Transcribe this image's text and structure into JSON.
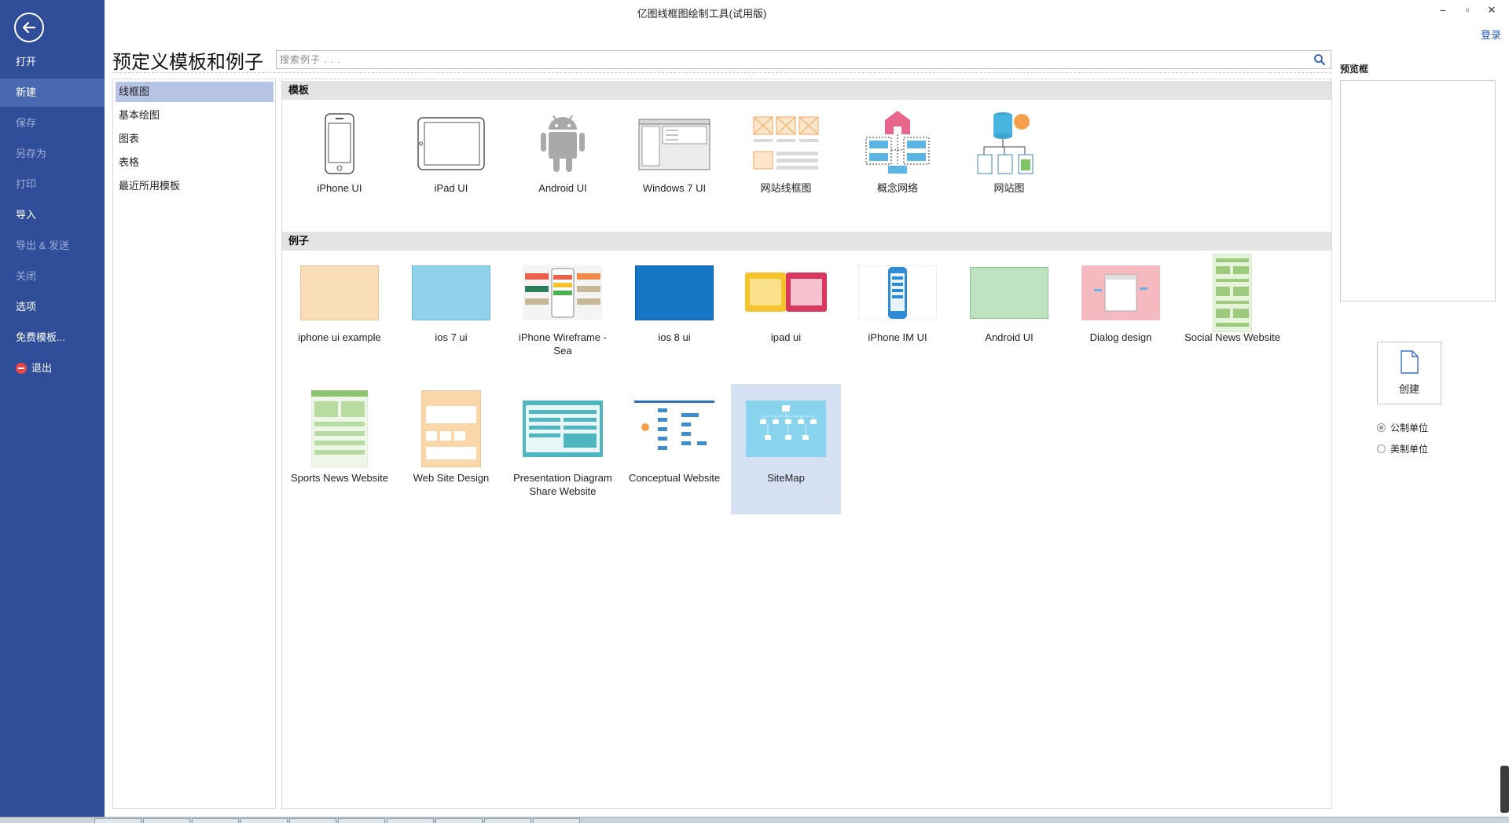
{
  "window": {
    "title": "亿图线框图绘制工具(试用版)",
    "minimize": "–",
    "restore": "▫",
    "close": "✕",
    "login": "登录"
  },
  "leftnav": {
    "items": [
      {
        "label": "打开",
        "state": "normal"
      },
      {
        "label": "新建",
        "state": "active"
      },
      {
        "label": "保存",
        "state": "disabled"
      },
      {
        "label": "另存为",
        "state": "disabled"
      },
      {
        "label": "打印",
        "state": "disabled"
      },
      {
        "label": "导入",
        "state": "normal"
      },
      {
        "label": "导出 & 发送",
        "state": "disabled"
      },
      {
        "label": "关闭",
        "state": "disabled"
      },
      {
        "label": "选项",
        "state": "normal"
      },
      {
        "label": "免费模板...",
        "state": "normal"
      },
      {
        "label": "退出",
        "state": "normal"
      }
    ]
  },
  "header": {
    "title": "预定义模板和例子",
    "search_placeholder": "搜索例子 . . ."
  },
  "categories": [
    {
      "label": "线框图",
      "active": true
    },
    {
      "label": "基本绘图",
      "active": false
    },
    {
      "label": "图表",
      "active": false
    },
    {
      "label": "表格",
      "active": false
    },
    {
      "label": "最近所用模板",
      "active": false
    }
  ],
  "sections": {
    "templates": {
      "title": "模板",
      "items": [
        {
          "label": "iPhone UI",
          "icon": "iphone-icon"
        },
        {
          "label": "iPad UI",
          "icon": "ipad-icon"
        },
        {
          "label": "Android UI",
          "icon": "android-icon"
        },
        {
          "label": "Windows 7 UI",
          "icon": "windows-window-icon"
        },
        {
          "label": "网站线框图",
          "icon": "website-wireframe-icon"
        },
        {
          "label": "概念网络",
          "icon": "concept-network-icon"
        },
        {
          "label": "网站图",
          "icon": "sitemap-icon"
        }
      ]
    },
    "examples": {
      "title": "例子",
      "items": [
        {
          "label": "iphone ui example",
          "color": "#f9dcb8",
          "selected": false
        },
        {
          "label": "ios 7 ui",
          "color": "#8fd2ea",
          "selected": false
        },
        {
          "label": "iPhone Wireframe - Sea",
          "color": "#f4f4f4",
          "selected": false
        },
        {
          "label": "ios 8 ui",
          "color": "#1576c6",
          "selected": false
        },
        {
          "label": "ipad ui",
          "color": "#f5c32c",
          "selected": false
        },
        {
          "label": "iPhone IM UI",
          "color": "#ffffff",
          "selected": false
        },
        {
          "label": "Android UI",
          "color": "#bfe2c0",
          "selected": false
        },
        {
          "label": "Dialog design",
          "color": "#f5b9c0",
          "selected": false
        },
        {
          "label": "Social News Website",
          "color": "#e8f3dd",
          "selected": false
        },
        {
          "label": "Sports News Website",
          "color": "#e4f0d9",
          "selected": false
        },
        {
          "label": "Web Site Design",
          "color": "#f9d7a8",
          "selected": false
        },
        {
          "label": "Presentation Diagram Share Website",
          "color": "#4fb6bf",
          "selected": false
        },
        {
          "label": "Conceptual Website",
          "color": "#ffffff",
          "selected": false
        },
        {
          "label": "SiteMap",
          "color": "#88d3ee",
          "selected": true
        }
      ]
    }
  },
  "preview": {
    "title": "预览框",
    "create_label": "创建",
    "units": [
      {
        "label": "公制单位",
        "checked": true
      },
      {
        "label": "美制单位",
        "checked": false
      }
    ]
  }
}
